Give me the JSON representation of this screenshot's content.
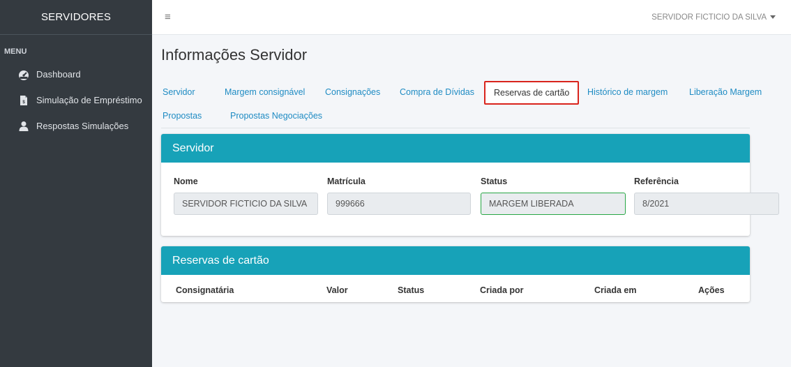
{
  "sidebar": {
    "brand": "SERVIDORES",
    "menu_header": "MENU",
    "items": [
      {
        "label": "Dashboard",
        "icon": "dashboard-icon"
      },
      {
        "label": "Simulação de Empréstimo",
        "icon": "file-icon"
      },
      {
        "label": "Respostas Simulações",
        "icon": "user-icon"
      }
    ]
  },
  "topbar": {
    "hamburger": "≡",
    "user_name": "SERVIDOR FICTICIO DA SILVA"
  },
  "page": {
    "title": "Informações Servidor"
  },
  "tabs": [
    {
      "label": "Servidor"
    },
    {
      "label": "Margem consignável"
    },
    {
      "label": "Consignações"
    },
    {
      "label": "Compra de Dívidas"
    },
    {
      "label": "Reservas de cartão",
      "active": true
    },
    {
      "label": "Histórico de margem"
    },
    {
      "label": "Liberação Margem"
    },
    {
      "label": "Propostas"
    },
    {
      "label": "Propostas Negociações"
    }
  ],
  "servidor_card": {
    "title": "Servidor",
    "fields": [
      {
        "label": "Nome",
        "value": "SERVIDOR FICTICIO DA SILVA"
      },
      {
        "label": "Matrícula",
        "value": "999666"
      },
      {
        "label": "Status",
        "value": "MARGEM LIBERADA"
      },
      {
        "label": "Referência",
        "value": "8/2021"
      }
    ]
  },
  "reservas_card": {
    "title": "Reservas de cartão",
    "columns": [
      "Consignatária",
      "Valor",
      "Status",
      "Criada por",
      "Criada em",
      "Ações"
    ]
  },
  "colors": {
    "sidebar_bg": "#343a40",
    "card_header": "#17a2b8",
    "link": "#1e8bc3",
    "highlight_border": "#d9241c",
    "success_border": "#28a745"
  }
}
